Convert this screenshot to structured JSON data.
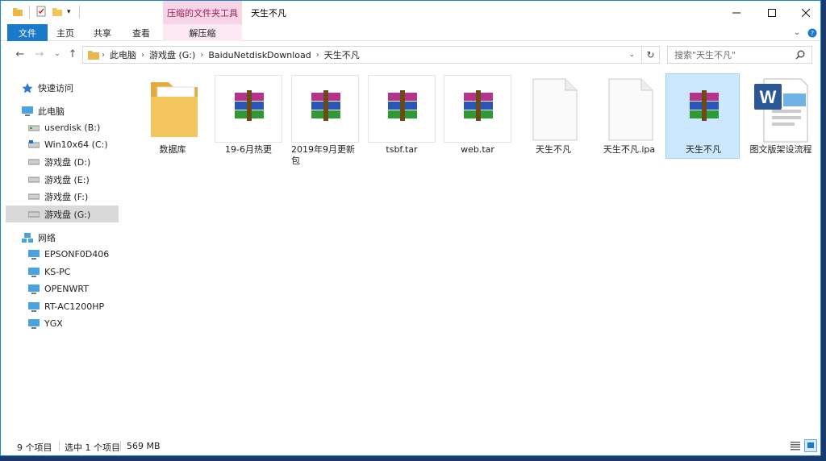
{
  "window": {
    "context_tab": "压缩的文件夹工具",
    "title": "天生不凡"
  },
  "ribbon": {
    "tabs": [
      "文件",
      "主页",
      "共享",
      "查看",
      "解压缩"
    ]
  },
  "address": {
    "crumbs": [
      "此电脑",
      "游戏盘 (G:)",
      "BaiduNetdiskDownload",
      "天生不凡"
    ],
    "search_placeholder": "搜索\"天生不凡\""
  },
  "sidebar": {
    "quick_access": "快速访问",
    "this_pc": "此电脑",
    "drives": [
      "userdisk (B:)",
      "Win10x64 (C:)",
      "游戏盘 (D:)",
      "游戏盘 (E:)",
      "游戏盘 (F:)",
      "游戏盘 (G:)"
    ],
    "network": "网络",
    "computers": [
      "EPSONF0D406",
      "KS-PC",
      "OPENWRT",
      "RT-AC1200HP",
      "YGX"
    ]
  },
  "files": [
    {
      "name": "数据库",
      "type": "folder"
    },
    {
      "name": "19-6月热更",
      "type": "rar"
    },
    {
      "name": "2019年9月更新包",
      "type": "rar"
    },
    {
      "name": "tsbf.tar",
      "type": "rar"
    },
    {
      "name": "web.tar",
      "type": "rar"
    },
    {
      "name": "天生不凡",
      "type": "blank"
    },
    {
      "name": "天生不凡.ipa",
      "type": "blank"
    },
    {
      "name": "天生不凡",
      "type": "rar",
      "selected": true
    },
    {
      "name": "图文版架设流程",
      "type": "word"
    }
  ],
  "status": {
    "count": "9 个项目",
    "selected": "选中 1 个项目",
    "size": "569 MB"
  },
  "colors": {
    "accent": "#1979ca",
    "selection": "#cce8ff",
    "context_tab": "#f8d5e6"
  }
}
